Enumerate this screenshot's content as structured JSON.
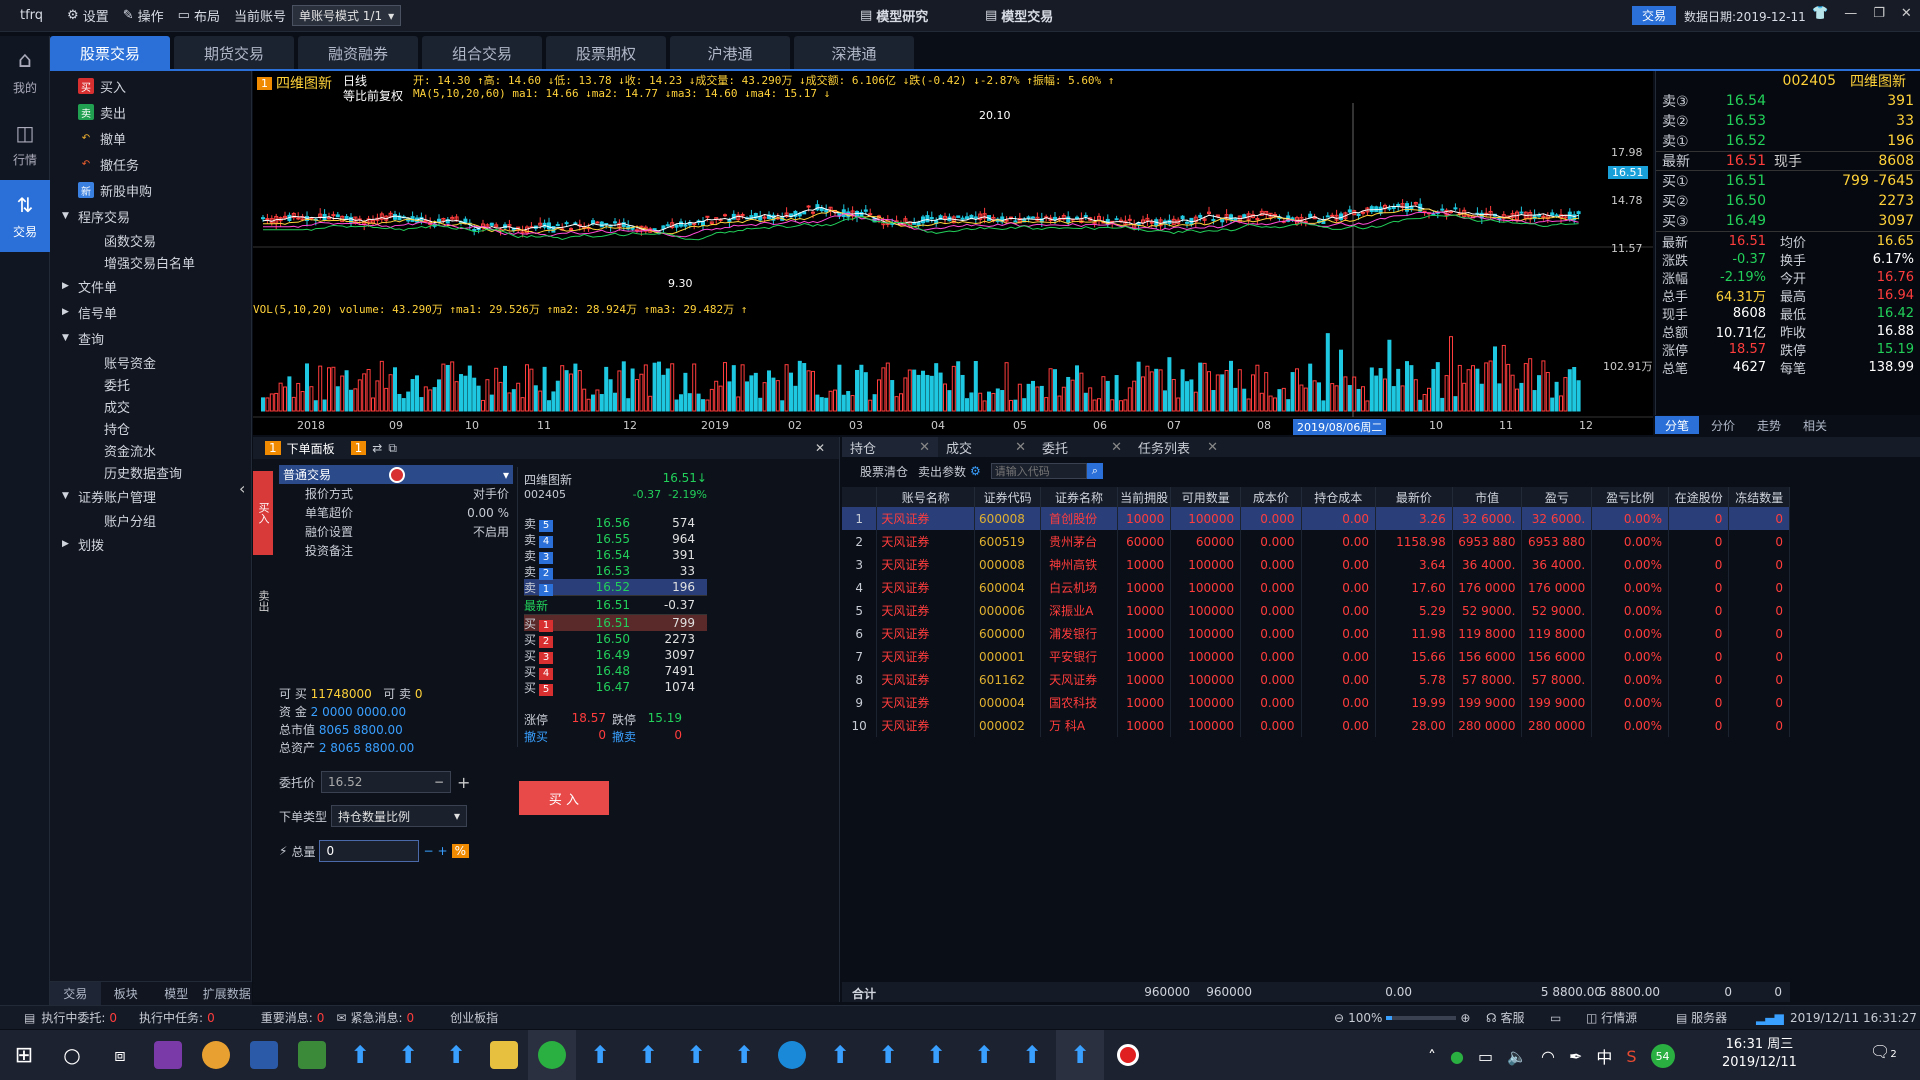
{
  "titlebar": {
    "app": "tfrq",
    "settings": "设置",
    "operate": "操作",
    "layout": "布局",
    "current_account_label": "当前账号",
    "account_mode": "单账号模式 1/1",
    "center_left": "模型研究",
    "center_right": "模型交易",
    "trade_badge": "交易",
    "data_date": "数据日期:2019-12-11"
  },
  "tabs": [
    "股票交易",
    "期货交易",
    "融资融券",
    "组合交易",
    "股票期权",
    "沪港通",
    "深港通"
  ],
  "rail": [
    "我的",
    "行情",
    "交易"
  ],
  "sidebar": {
    "buy": "买入",
    "sell": "卖出",
    "cancel": "撤单",
    "cancel_task": "撤任务",
    "ipo": "新股申购",
    "program": "程序交易",
    "func_trade": "函数交易",
    "whitelist": "增强交易白名单",
    "file_order": "文件单",
    "signal_order": "信号单",
    "query": "查询",
    "q_funds": "账号资金",
    "q_order": "委托",
    "q_deal": "成交",
    "q_position": "持仓",
    "q_flow": "资金流水",
    "q_history": "历史数据查询",
    "sec_acct": "证券账户管理",
    "acct_group": "账户分组",
    "transfer": "划拨"
  },
  "sidebottom": [
    "交易",
    "板块",
    "模型",
    "扩展数据"
  ],
  "chart": {
    "stock_name": "四维图新",
    "period": "日线",
    "adjust": "等比前复权",
    "ohlc": "开: 14.30 ↑高: 14.60 ↓低: 13.78 ↓收: 14.23 ↓成交量: 43.290万 ↓成交额: 6.106亿 ↓跌(-0.42) ↓-2.87% ↑振幅: 5.60% ↑",
    "ma": "MA(5,10,20,60) ma1: 14.66 ↓ma2: 14.77 ↓ma3: 14.60 ↓ma4: 15.17 ↓",
    "vol": "VOL(5,10,20) volume: 43.290万 ↑ma1: 29.526万 ↑ma2: 28.924万 ↑ma3: 29.482万 ↑",
    "y_labels": [
      "17.98",
      "14.78",
      "11.57"
    ],
    "price_tag": "16.51",
    "vol_label": "102.91万",
    "peak_label": "20.10",
    "low_label": "9.30",
    "x_labels": [
      "2018",
      "09",
      "10",
      "11",
      "12",
      "2019",
      "02",
      "03",
      "04",
      "05",
      "06",
      "07",
      "08",
      "2019/08/06周二",
      "10",
      "11",
      "12"
    ]
  },
  "quote": {
    "code": "002405",
    "name": "四维图新",
    "asks": [
      {
        "l": "卖③",
        "p": "16.54",
        "q": "391"
      },
      {
        "l": "卖②",
        "p": "16.53",
        "q": "33"
      },
      {
        "l": "卖①",
        "p": "16.52",
        "q": "196"
      }
    ],
    "last": {
      "l": "最新",
      "p": "16.51",
      "t": "现手",
      "q": "8608"
    },
    "bids": [
      {
        "l": "买①",
        "p": "16.51",
        "q": "799 -7645"
      },
      {
        "l": "买②",
        "p": "16.50",
        "q": "2273"
      },
      {
        "l": "买③",
        "p": "16.49",
        "q": "3097"
      }
    ],
    "stats": [
      {
        "a": "最新",
        "b": "16.51",
        "c": "均价",
        "d": "16.65"
      },
      {
        "a": "涨跌",
        "b": "-0.37",
        "c": "换手",
        "d": "6.17%"
      },
      {
        "a": "涨幅",
        "b": "-2.19%",
        "c": "今开",
        "d": "16.76"
      },
      {
        "a": "总手",
        "b": "64.31万",
        "c": "最高",
        "d": "16.94"
      },
      {
        "a": "现手",
        "b": "8608",
        "c": "最低",
        "d": "16.42"
      },
      {
        "a": "总额",
        "b": "10.71亿",
        "c": "昨收",
        "d": "16.88"
      },
      {
        "a": "涨停",
        "b": "18.57",
        "c": "跌停",
        "d": "15.19"
      },
      {
        "a": "总笔",
        "b": "4627",
        "c": "每笔",
        "d": "138.99"
      }
    ],
    "tabs": [
      "分笔",
      "分价",
      "走势",
      "相关"
    ]
  },
  "order": {
    "panel_title": "下单面板",
    "mode": "普通交易",
    "price_mode_label": "报价方式",
    "price_mode": "对手价",
    "slip_label": "单笔超价",
    "slip": "0.00 %",
    "financing_label": "融价设置",
    "financing": "不启用",
    "note_label": "投资备注",
    "buy_side": "买入",
    "sell_side": "卖出",
    "can_buy_label": "可 买",
    "can_buy": "11748000",
    "can_sell_label": "可 卖",
    "can_sell": "0",
    "cash_label": "资 金",
    "cash": "2 0000 0000.00",
    "mv_label": "总市值",
    "mv": "8065 8800.00",
    "assets_label": "总资产",
    "assets": "2 8065 8800.00",
    "price_label": "委托价",
    "price_placeholder": "16.52",
    "type_label": "下单类型",
    "type": "持仓数量比例",
    "qty_label": "总量",
    "qty": "0",
    "buy_button": "买 入"
  },
  "book": {
    "name": "四维图新",
    "code": "002405",
    "price": "16.51↓",
    "chg": "-0.37",
    "pct": "-2.19%",
    "asks": [
      {
        "l": "卖",
        "n": "5",
        "p": "16.56",
        "q": "574"
      },
      {
        "l": "卖",
        "n": "4",
        "p": "16.55",
        "q": "964"
      },
      {
        "l": "卖",
        "n": "3",
        "p": "16.54",
        "q": "391"
      },
      {
        "l": "卖",
        "n": "2",
        "p": "16.53",
        "q": "33"
      },
      {
        "l": "卖",
        "n": "1",
        "p": "16.52",
        "q": "196"
      }
    ],
    "last_label": "最新",
    "last": "16.51",
    "last_chg": "-0.37",
    "bids": [
      {
        "l": "买",
        "n": "1",
        "p": "16.51",
        "q": "799"
      },
      {
        "l": "买",
        "n": "2",
        "p": "16.50",
        "q": "2273"
      },
      {
        "l": "买",
        "n": "3",
        "p": "16.49",
        "q": "3097"
      },
      {
        "l": "买",
        "n": "4",
        "p": "16.48",
        "q": "7491"
      },
      {
        "l": "买",
        "n": "5",
        "p": "16.47",
        "q": "1074"
      }
    ],
    "limit_up_label": "涨停",
    "limit_up": "18.57",
    "limit_down_label": "跌停",
    "limit_down": "15.19",
    "buy_cancel_label": "撤买",
    "buy_cancel": "0",
    "sell_cancel_label": "撤卖",
    "sell_cancel": "0"
  },
  "holdings": {
    "tabs": [
      "持仓",
      "成交",
      "委托",
      "任务列表"
    ],
    "clear_label": "股票清仓",
    "sell_params": "卖出参数",
    "search_placeholder": "请输入代码",
    "headers": [
      "",
      "账号名称",
      "证券代码",
      "证券名称",
      "当前拥股",
      "可用数量",
      "成本价",
      "持仓成本",
      "最新价",
      "市值",
      "盈亏",
      "盈亏比例",
      "在途股份",
      "冻结数量"
    ],
    "rows": [
      [
        "1",
        "天风证券",
        "600008",
        "首创股份",
        "10000",
        "100000",
        "0.000",
        "0.00",
        "3.26",
        "32 6000.",
        "32 6000.",
        "0.00%",
        "0",
        "0"
      ],
      [
        "2",
        "天风证券",
        "600519",
        "贵州茅台",
        "60000",
        "60000",
        "0.000",
        "0.00",
        "1158.98",
        "6953 880",
        "6953 880",
        "0.00%",
        "0",
        "0"
      ],
      [
        "3",
        "天风证券",
        "000008",
        "神州高铁",
        "10000",
        "100000",
        "0.000",
        "0.00",
        "3.64",
        "36 4000.",
        "36 4000.",
        "0.00%",
        "0",
        "0"
      ],
      [
        "4",
        "天风证券",
        "600004",
        "白云机场",
        "10000",
        "100000",
        "0.000",
        "0.00",
        "17.60",
        "176 0000",
        "176 0000",
        "0.00%",
        "0",
        "0"
      ],
      [
        "5",
        "天风证券",
        "000006",
        "深振业A",
        "10000",
        "100000",
        "0.000",
        "0.00",
        "5.29",
        "52 9000.",
        "52 9000.",
        "0.00%",
        "0",
        "0"
      ],
      [
        "6",
        "天风证券",
        "600000",
        "浦发银行",
        "10000",
        "100000",
        "0.000",
        "0.00",
        "11.98",
        "119 8000",
        "119 8000",
        "0.00%",
        "0",
        "0"
      ],
      [
        "7",
        "天风证券",
        "000001",
        "平安银行",
        "10000",
        "100000",
        "0.000",
        "0.00",
        "15.66",
        "156 6000",
        "156 6000",
        "0.00%",
        "0",
        "0"
      ],
      [
        "8",
        "天风证券",
        "601162",
        "天风证券",
        "10000",
        "100000",
        "0.000",
        "0.00",
        "5.78",
        "57 8000.",
        "57 8000.",
        "0.00%",
        "0",
        "0"
      ],
      [
        "9",
        "天风证券",
        "000004",
        "国农科技",
        "10000",
        "100000",
        "0.000",
        "0.00",
        "19.99",
        "199 9000",
        "199 9000",
        "0.00%",
        "0",
        "0"
      ],
      [
        "10",
        "天风证券",
        "000002",
        "万 科A",
        "10000",
        "100000",
        "0.000",
        "0.00",
        "28.00",
        "280 0000",
        "280 0000",
        "0.00%",
        "0",
        "0"
      ]
    ],
    "sum_label": "合计",
    "sum_hold": "960000",
    "sum_avail": "960000",
    "sum_cost": "0.00",
    "sum_mv": "5 8800.00",
    "sum_pl": "5 8800.00",
    "sum_transit": "0",
    "sum_frozen": "0"
  },
  "status": {
    "exec_order_label": "执行中委托:",
    "exec_order": "0",
    "exec_task_label": "执行中任务:",
    "exec_task": "0",
    "important_label": "重要消息:",
    "important": "0",
    "urgent_label": "紧急消息:",
    "urgent": "0",
    "index_label": "创业板指",
    "zoom": "100%",
    "service": "客服",
    "quote_src": "行情源",
    "server": "服务器",
    "datetime": "2019/12/11 16:31:27"
  },
  "taskbar": {
    "time": "16:31 周三",
    "date": "2019/12/11",
    "ime": "中",
    "badge": "54",
    "notif": "2"
  },
  "colors": {
    "accent": "#2a70d8",
    "up": "#ff3d3d",
    "down": "#22d05a"
  }
}
